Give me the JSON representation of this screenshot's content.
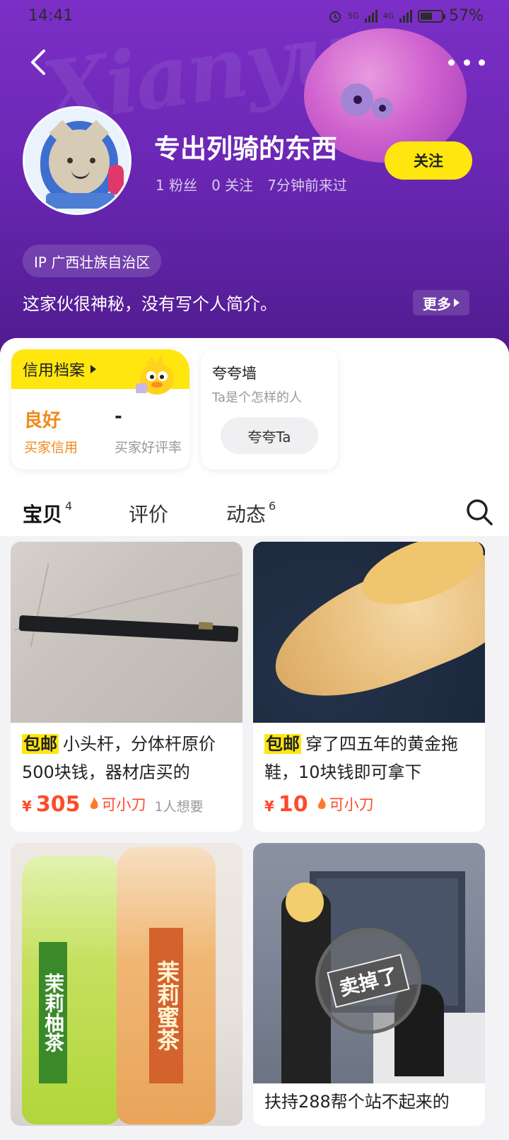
{
  "status_bar": {
    "time": "14:41",
    "network1": "5G",
    "network2": "4G",
    "battery": "57%"
  },
  "profile": {
    "nickname": "专出列骑的东西",
    "fans": "1 粉丝",
    "following": "0 关注",
    "last_seen": "7分钟前来过",
    "follow_label": "关注",
    "ip": "IP 广西壮族自治区",
    "bio": "这家伙很神秘，没有写个人简介。",
    "more_label": "更多"
  },
  "credit": {
    "title": "信用档案",
    "good": "良好",
    "good_label": "买家信用",
    "rate": "-",
    "rate_label": "买家好评率"
  },
  "praise": {
    "title": "夸夸墙",
    "subtitle": "Ta是个怎样的人",
    "button": "夸夸Ta"
  },
  "tabs": [
    {
      "label": "宝贝",
      "count": "4"
    },
    {
      "label": "评价",
      "count": ""
    },
    {
      "label": "动态",
      "count": "6"
    }
  ],
  "items": [
    {
      "tag": "包邮",
      "title": "小头杆，分体杆原价500块钱，器材店买的",
      "currency": "¥",
      "price": "305",
      "bargain": "可小刀",
      "wants": "1人想要"
    },
    {
      "tag": "包邮",
      "title": "穿了四五年的黄金拖鞋，10块钱即可拿下",
      "currency": "¥",
      "price": "10",
      "bargain": "可小刀",
      "wants": ""
    },
    {
      "tag": "",
      "title": "",
      "currency": "",
      "price": "",
      "bargain": "",
      "wants": ""
    },
    {
      "tag": "",
      "title": "扶持288帮个站不起来的",
      "currency": "",
      "price": "",
      "bargain": "",
      "wants": ""
    }
  ],
  "image_text": {
    "tea1": "茉莉柚茶",
    "tea2": "茉莉蜜茶",
    "stamp": "卖掉了"
  },
  "colors": {
    "brand_yellow": "#ffe60f",
    "header_purple": "#6a27b4",
    "price_red": "#ff4a2a",
    "credit_orange": "#f08a1c"
  }
}
